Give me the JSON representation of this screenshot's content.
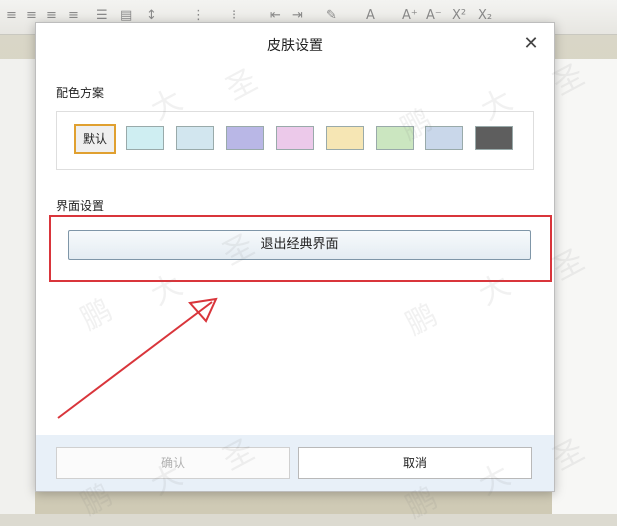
{
  "dialog": {
    "title": "皮肤设置",
    "close_icon": "close-icon",
    "color_scheme_label": "配色方案",
    "default_swatch_label": "默认",
    "swatches": [
      {
        "name": "light-cyan",
        "color": "#cfeef2"
      },
      {
        "name": "light-blue",
        "color": "#d2e6ef"
      },
      {
        "name": "lavender",
        "color": "#b9b7e6"
      },
      {
        "name": "pink",
        "color": "#ecc9ea"
      },
      {
        "name": "light-yellow",
        "color": "#f6e6b4"
      },
      {
        "name": "light-green",
        "color": "#cbe6c0"
      },
      {
        "name": "steel-blue",
        "color": "#c9d7ea"
      },
      {
        "name": "dark-gray",
        "color": "#5e5e5e"
      }
    ],
    "ui_settings_label": "界面设置",
    "exit_classic_button": "退出经典界面",
    "confirm_button": "确认",
    "cancel_button": "取消"
  },
  "watermark_text": [
    "鹏",
    "大",
    "圣"
  ],
  "colors": {
    "highlight": "#d9353b",
    "default_border": "#e0a030",
    "footer_bg": "#e8f0f8"
  }
}
